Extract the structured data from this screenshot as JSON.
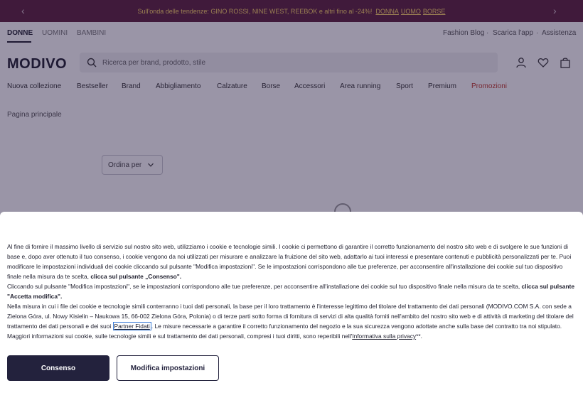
{
  "promo": {
    "text": "Sull'onda delle tendenze: GINO ROSSI, NINE WEST, REEBOK e altri fino al -24%!",
    "links": [
      "DONNA",
      "UOMO",
      "BORSE"
    ],
    "prev_arrow": "‹",
    "next_arrow": "›"
  },
  "gender_tabs": [
    "DONNE",
    "UOMINI",
    "BAMBINI"
  ],
  "utility_links": [
    "Fashion Blog",
    "Scarica l'app",
    "Assistenza"
  ],
  "utility_separator": "·",
  "logo": "MODIVO",
  "search": {
    "placeholder": "Ricerca per brand, prodotto, stile"
  },
  "header_icons": [
    "user-icon",
    "heart-icon",
    "bag-icon"
  ],
  "nav": {
    "items": [
      "Nuova collezione",
      "Bestseller",
      "Brand",
      "Abbigliamento",
      "Calzature",
      "Borse",
      "Accessori",
      "Area running",
      "Sport",
      "Premium",
      "Promozioni"
    ]
  },
  "breadcrumb": "Pagina principale",
  "sort": {
    "label": "Ordina per"
  },
  "cookie": {
    "p1": "Al fine di fornire il massimo livello di servizio sul nostro sito web, utilizziamo i cookie e tecnologie simili. I cookie ci permettono di garantire il corretto funzionamento del nostro sito web e di svolgere le sue funzioni di base e, dopo aver ottenuto il tuo consenso, i cookie vengono da noi utilizzati per misurare e analizzare la fruizione del sito web, adattarlo ai tuoi interessi e presentare contenuti e pubblicità personalizzati per te. Puoi modificare le impostazioni individuali dei cookie cliccando sul pulsante \"Modifica impostazioni\". Se le impostazioni corrispondono alle tue preferenze, per acconsentire all'installazione dei cookie sul tuo dispositivo finale nella misura da te scelta, ",
    "p1_bold": "clicca sul pulsante „Consenso\".",
    "p2": "Cliccando sul pulsante \"Modifica impostazioni\", se le impostazioni corrispondono alle tue preferenze, per acconsentire all'installazione dei cookie sul tuo dispositivo finale nella misura da te scelta, ",
    "p2_bold": "clicca sul pulsante \"Accetta modifica\".",
    "p3_a": "Nella misura in cui i file dei cookie e tecnologie simili conterranno i tuoi dati personali, la base per il loro trattamento è l'interesse legittimo del titolare del trattamento dei dati personali (MODIVO.COM S.A. con sede a Zielona Góra, ul. Nowy Kisielin – Naukowa 15, 66-002 Zielona Góra, Polonia) o di terze parti sotto forma di fornitura di servizi di alta qualità forniti nell'ambito del nostro sito web e di attività di marketing del titolare del trattamento dei dati personali e dei suoi ",
    "partner_link": "Partner Fidati",
    "p3_b": ". Le misure necessarie a garantire il corretto funzionamento del negozio e la sua sicurezza vengono adottate anche sulla base del contratto tra noi stipulato. Maggiori informazioni sui cookie, sulle tecnologie simili e sul trattamento dei dati personali, compresi i tuoi diritti, sono reperibili nell'",
    "privacy_link": "Informativa sulla privacy",
    "privacy_suffix": "**.",
    "consent_button": "Consenso",
    "modify_button": "Modifica impostazioni"
  },
  "colors": {
    "promo_bg": "#5c1f3b",
    "promo_text": "#ffd966",
    "brand_dark": "#23223d",
    "promo_nav": "#c0392b"
  }
}
